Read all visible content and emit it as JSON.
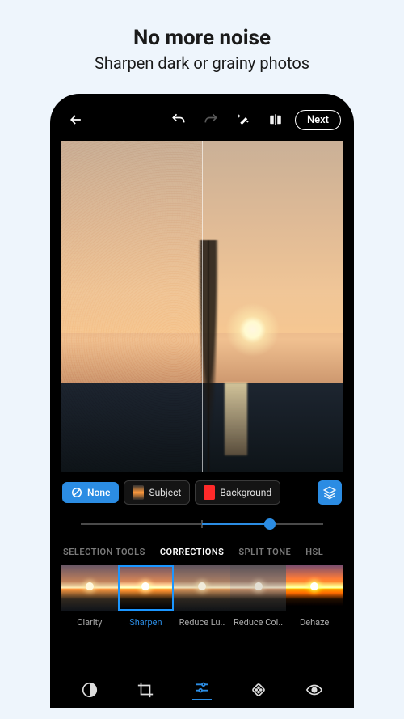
{
  "promo": {
    "title": "No more noise",
    "subtitle": "Sharpen dark or grainy photos"
  },
  "topbar": {
    "next_label": "Next"
  },
  "mask": {
    "none_label": "None",
    "subject_label": "Subject",
    "background_label": "Background"
  },
  "slider": {
    "value_pct": 78
  },
  "tabs": {
    "items": [
      {
        "label": "SELECTION TOOLS"
      },
      {
        "label": "CORRECTIONS"
      },
      {
        "label": "SPLIT TONE"
      },
      {
        "label": "HSL"
      }
    ],
    "active_index": 1
  },
  "filters": {
    "items": [
      {
        "label": "Clarity"
      },
      {
        "label": "Sharpen"
      },
      {
        "label": "Reduce Lu.."
      },
      {
        "label": "Reduce Col.."
      },
      {
        "label": "Dehaze"
      }
    ],
    "active_index": 1
  },
  "bottom_nav": {
    "icons": [
      "looks-icon",
      "crop-icon",
      "adjust-icon",
      "heal-icon",
      "redeye-icon"
    ],
    "active_index": 2
  },
  "colors": {
    "accent": "#2b8ce3"
  }
}
